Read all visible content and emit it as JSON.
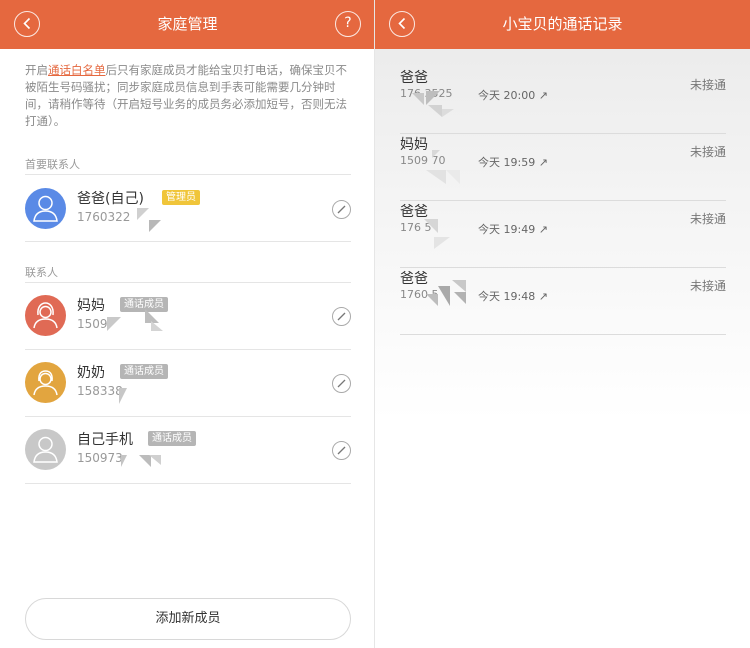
{
  "left": {
    "header": {
      "title": "家庭管理",
      "back_icon": "back-icon",
      "help_label": "?"
    },
    "notice": {
      "prefix": "开启",
      "link": "通话白名单",
      "suffix": "后只有家庭成员才能给宝贝打电话，确保宝贝不被陌生号码骚扰；同步家庭成员信息到手表可能需要几分钟时间，请稍作等待（开启短号业务的成员务必添加短号，否则无法打通）。"
    },
    "primary_section_label": "首要联系人",
    "primary": {
      "name": "爸爸(自己)",
      "phone": "1760322",
      "badge": "管理员",
      "avatar_color": "#5a8ae6"
    },
    "contacts_section_label": "联系人",
    "contacts": [
      {
        "name": "妈妈",
        "phone": "1509",
        "badge": "通话成员",
        "avatar_color": "#e06a55"
      },
      {
        "name": "奶奶",
        "phone": "158338",
        "badge": "通话成员",
        "avatar_color": "#e2a53f"
      },
      {
        "name": "自己手机",
        "phone": "150973",
        "badge": "通话成员",
        "avatar_color": "#c8c8c8"
      }
    ],
    "add_button": "添加新成员"
  },
  "right": {
    "header": {
      "title": "小宝贝的通话记录",
      "back_icon": "back-icon"
    },
    "calls": [
      {
        "name": "爸爸",
        "phone": "176   3525",
        "time": "今天 20:00",
        "status": "未接通"
      },
      {
        "name": "妈妈",
        "phone": "1509    70",
        "time": "今天 19:59",
        "status": "未接通"
      },
      {
        "name": "爸爸",
        "phone": "176     5",
        "time": "今天 19:49",
        "status": "未接通"
      },
      {
        "name": "爸爸",
        "phone": "1760    5",
        "time": "今天 19:48",
        "status": "未接通"
      }
    ]
  },
  "colors": {
    "accent": "#e5683f",
    "admin_badge": "#f0c53a",
    "member_badge": "#b5b5b5"
  }
}
